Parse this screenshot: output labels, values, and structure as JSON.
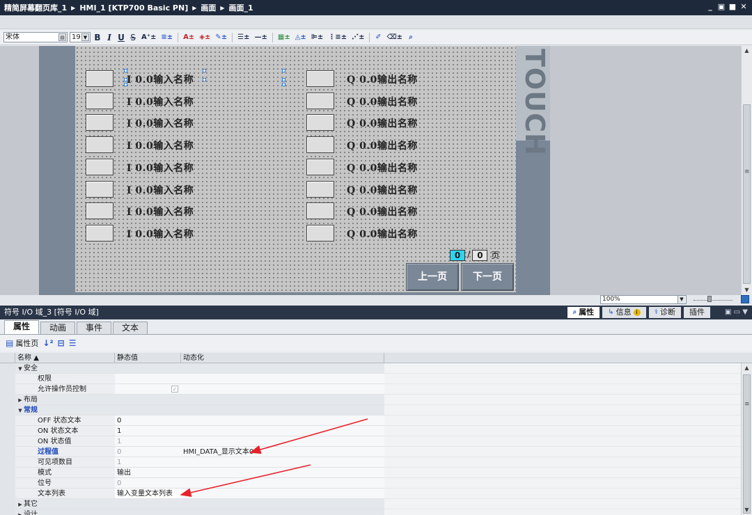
{
  "titlebar": {
    "crumbs": [
      "精简屏幕翻页库_1",
      "HMI_1 [KTP700 Basic PN]",
      "画面",
      "画面_1"
    ],
    "controls": [
      "_",
      "▣",
      "■",
      "✕"
    ]
  },
  "toolbar": {
    "font": "宋体",
    "size": "19",
    "bold": "B",
    "italic": "I",
    "underline": "U",
    "strike": "S",
    "fontsize_up": "A⁺±",
    "align": "≡±",
    "text_color": "A±",
    "fill_color": "◈±",
    "line_color": "✎±",
    "line_style": "☰±",
    "line_width": "—±",
    "arrange": "▦±",
    "fill": "◬±",
    "align_obj": "⊫±",
    "distribute": "⋮≡±",
    "spacing": "⋰±",
    "format_paint": "✐",
    "eraser": "⌫±",
    "zoom_sel": "⌕"
  },
  "screen": {
    "brand": "TOUCH",
    "input_label": "I 0.0输入名称",
    "output_label": "Q 0.0输出名称",
    "rows": 8,
    "pager": {
      "current": "0",
      "slash": "/",
      "total": "0",
      "unit": "页"
    },
    "prev_button": "上一页",
    "next_button": "下一页"
  },
  "zoom": {
    "value": "100%"
  },
  "inspector": {
    "title": "符号 I/O 域_3 [符号 I/O 域]",
    "tabs": [
      {
        "label": "属性",
        "icon": "Q"
      },
      {
        "label": "信息",
        "icon": "ℹ"
      },
      {
        "label": "诊断",
        "icon": "⚕"
      }
    ],
    "plugins_tab": "插件",
    "subtabs": [
      "属性",
      "动画",
      "事件",
      "文本"
    ],
    "property_page": "属性页",
    "columns": {
      "name": "名称",
      "static": "静态值",
      "dynamic": "动态化"
    },
    "rows": [
      {
        "kind": "group",
        "expanded": true,
        "name": "安全",
        "static": "",
        "dynamic": ""
      },
      {
        "kind": "item",
        "name": "权限",
        "static": "",
        "dynamic": ""
      },
      {
        "kind": "item",
        "name": "允许操作员控制",
        "static": "✓",
        "dynamic": "",
        "checkbox": true
      },
      {
        "kind": "group",
        "expanded": false,
        "name": "布局",
        "static": "",
        "dynamic": ""
      },
      {
        "kind": "group",
        "expanded": true,
        "name": "常规",
        "static": "",
        "dynamic": "",
        "highlight": true
      },
      {
        "kind": "item",
        "name": "OFF 状态文本",
        "static": "0",
        "dynamic": ""
      },
      {
        "kind": "item",
        "name": "ON 状态文本",
        "static": "1",
        "dynamic": ""
      },
      {
        "kind": "item",
        "name": "ON 状态值",
        "static": "1",
        "dynamic": "",
        "muted": true
      },
      {
        "kind": "item",
        "name": "过程值",
        "static": "0",
        "dynamic": "HMI_DATA_显示文本0",
        "highlight": true,
        "muted": true
      },
      {
        "kind": "item",
        "name": "可见项数目",
        "static": "1",
        "dynamic": "",
        "muted": true
      },
      {
        "kind": "item",
        "name": "模式",
        "static": "输出",
        "dynamic": ""
      },
      {
        "kind": "item",
        "name": "位号",
        "static": "0",
        "dynamic": "",
        "muted": true
      },
      {
        "kind": "item",
        "name": "文本列表",
        "static": "输入变量文本列表",
        "dynamic": "",
        "white": true
      },
      {
        "kind": "group",
        "expanded": false,
        "name": "其它",
        "static": "",
        "dynamic": ""
      },
      {
        "kind": "group",
        "expanded": false,
        "name": "设计",
        "static": "",
        "dynamic": ""
      }
    ]
  },
  "colors": {
    "titlebar": "#1e2a3c",
    "screen_frame": "#7a8796",
    "pager_current": "#2fd3f0",
    "arrow": "#e8202a",
    "highlight_text": "#1c47b8"
  }
}
